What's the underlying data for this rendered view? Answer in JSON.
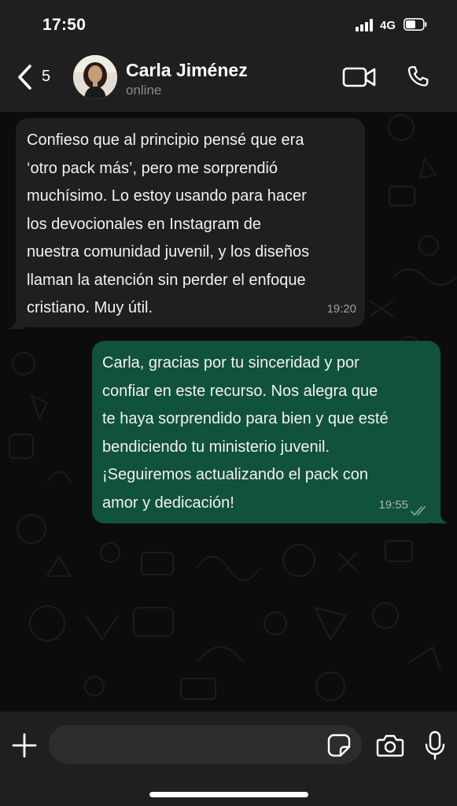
{
  "status_bar": {
    "time": "17:50",
    "network": "4G",
    "icons": [
      "signal-bars-icon",
      "battery-icon"
    ]
  },
  "header": {
    "back_count": "5",
    "contact_name": "Carla Jiménez",
    "contact_status": "online",
    "icons": [
      "back-chevron-icon",
      "video-call-icon",
      "phone-call-icon"
    ]
  },
  "messages": [
    {
      "direction": "incoming",
      "text": "Confieso que al principio pensé que era\n‘otro pack más’, pero me sorprendió\nmuchísimo. Lo estoy usando para hacer\nlos devocionales en Instagram de\nnuestra comunidad juvenil, y los diseños\nllaman la atención sin perder el enfoque\ncristiano. Muy útil.",
      "time": "19:20"
    },
    {
      "direction": "outgoing",
      "text": "Carla, gracias por tu sinceridad y por\nconfiar en este recurso. Nos alegra que\nte haya sorprendido para bien y que esté\nbendiciendo tu ministerio juvenil.\n¡Seguiremos actualizando el pack con\namor y dedicación!",
      "time": "19:55",
      "status": "read"
    }
  ],
  "composer": {
    "input_value": "",
    "icons": [
      "plus-icon",
      "sticker-icon",
      "camera-icon",
      "microphone-icon"
    ]
  },
  "colors": {
    "bar_background": "#1f1f1f",
    "chat_background": "#0c0c0c",
    "incoming_bubble": "#1f1f1f",
    "outgoing_bubble": "#11523a",
    "secondary_text": "#8a8a8a"
  }
}
